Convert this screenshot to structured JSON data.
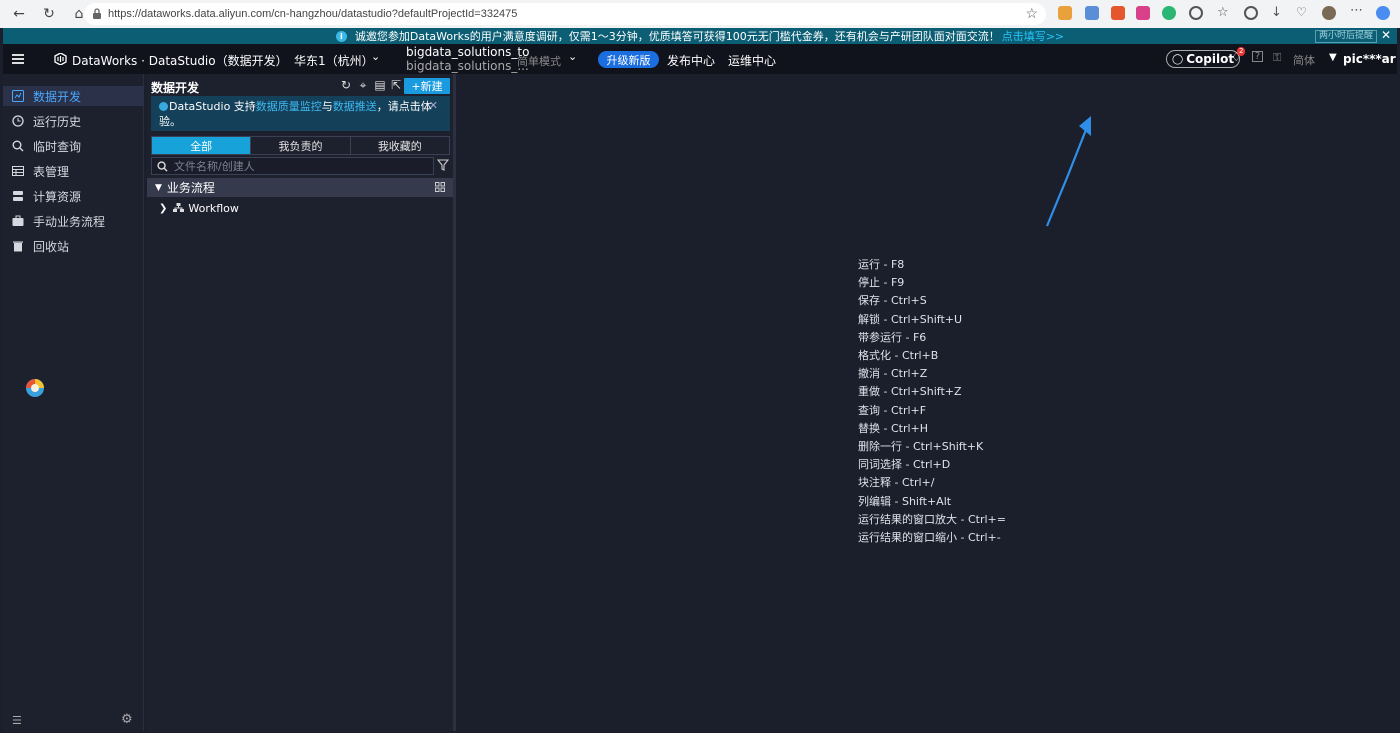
{
  "browser": {
    "url": "https://dataworks.data.aliyun.com/cn-hangzhou/datastudio?defaultProjectId=332475"
  },
  "banner": {
    "text": "诚邀您参加DataWorks的用户满意度调研，仅需1～3分钟，优质填答可获得100元无门槛代金券，还有机会与产研团队面对面交流！",
    "link": "点击填写>>",
    "remind": "两小时后提醒",
    "close": "✕"
  },
  "topbar": {
    "app_title": "DataWorks · DataStudio（数据开发）",
    "region": "华东1（杭州）",
    "project_line1": "bigdata_solutions_to",
    "project_line2": "bigdata_solutions_...",
    "mode": "简单模式",
    "upgrade": "升级新版",
    "release": "发布中心",
    "ops": "运维中心",
    "copilot": "Copilot",
    "notify_count": "2",
    "lang": "简体",
    "user": "pic***ar"
  },
  "sidebar": {
    "items": [
      {
        "label": "数据开发",
        "icon": "code-icon"
      },
      {
        "label": "运行历史",
        "icon": "clock-icon"
      },
      {
        "label": "临时查询",
        "icon": "search-icon"
      },
      {
        "label": "表管理",
        "icon": "table-icon"
      },
      {
        "label": "计算资源",
        "icon": "database-icon"
      },
      {
        "label": "手动业务流程",
        "icon": "briefcase-icon"
      },
      {
        "label": "回收站",
        "icon": "trash-icon"
      }
    ]
  },
  "panel": {
    "title": "数据开发",
    "new_label": "+新建",
    "tip_pre": "DataStudio 支持",
    "tip_link1": "数据质量监控",
    "tip_mid": "与",
    "tip_link2": "数据推送",
    "tip_post": "，请点击体验。",
    "tabs": [
      "全部",
      "我负责的",
      "我收藏的"
    ],
    "search_placeholder": "文件名称/创建人",
    "tree_header": "业务流程",
    "tree_row": "Workflow"
  },
  "shortcuts": [
    "运行 - F8",
    "停止 - F9",
    "保存 - Ctrl+S",
    "解锁 - Ctrl+Shift+U",
    "带参运行 - F6",
    "格式化 - Ctrl+B",
    "撤消 - Ctrl+Z",
    "重做 - Ctrl+Shift+Z",
    "查询 - Ctrl+F",
    "替换 - Ctrl+H",
    "删除一行 - Ctrl+Shift+K",
    "同词选择 - Ctrl+D",
    "块注释 - Ctrl+/",
    "列编辑 - Shift+Alt",
    "运行结果的窗口放大 - Ctrl+=",
    "运行结果的窗口缩小 - Ctrl+-"
  ],
  "colors": {
    "accent": "#1a9be0",
    "active_tab": "#17a3da",
    "upgrade": "#1a6ee0"
  }
}
